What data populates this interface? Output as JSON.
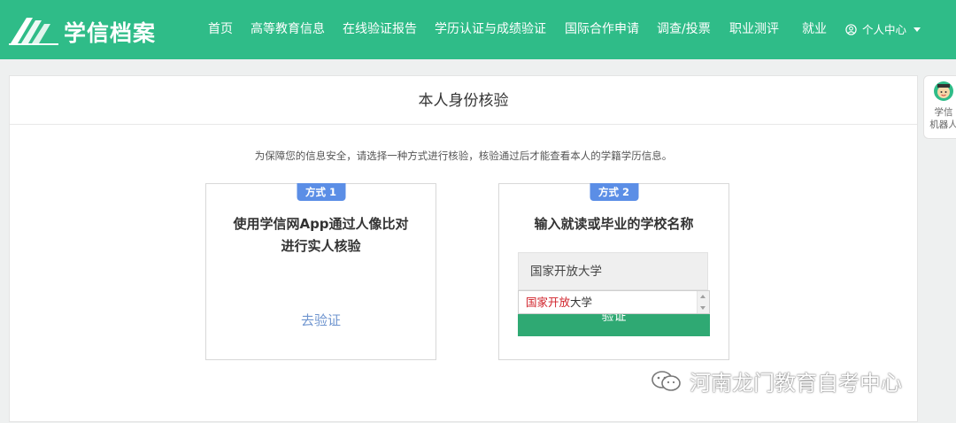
{
  "header": {
    "logo_text": "学信档案",
    "nav": [
      {
        "label": "首页"
      },
      {
        "label": "高等教育信息"
      },
      {
        "label": "在线验证报告"
      },
      {
        "label": "学历认证与成绩验证"
      },
      {
        "label": "国际合作申请"
      },
      {
        "label": "调查/投票"
      },
      {
        "label": "职业测评"
      },
      {
        "label": "就业"
      }
    ],
    "user_menu": "个人中心"
  },
  "main": {
    "title": "本人身份核验",
    "notice": "为保障您的信息安全，请选择一种方式进行核验，核验通过后才能查看本人的学籍学历信息。",
    "methods": [
      {
        "badge": "方式 1",
        "heading_line1": "使用学信网App通过人像比对",
        "heading_line2": "进行实人核验",
        "link": "去验证"
      },
      {
        "badge": "方式 2",
        "heading": "输入就读或毕业的学校名称",
        "input_value": "国家开放大学",
        "button": "验证",
        "suggestion_highlight": "国家开放",
        "suggestion_rest": "大学"
      }
    ]
  },
  "robot": {
    "line1": "学信",
    "line2": "机器人"
  },
  "watermark": "河南龙门教育自考中心",
  "colors": {
    "brand": "#2fbc88",
    "badge": "#5b8ee6",
    "link": "#6f95cf",
    "button": "#2fa973",
    "highlight": "#d0222a"
  }
}
